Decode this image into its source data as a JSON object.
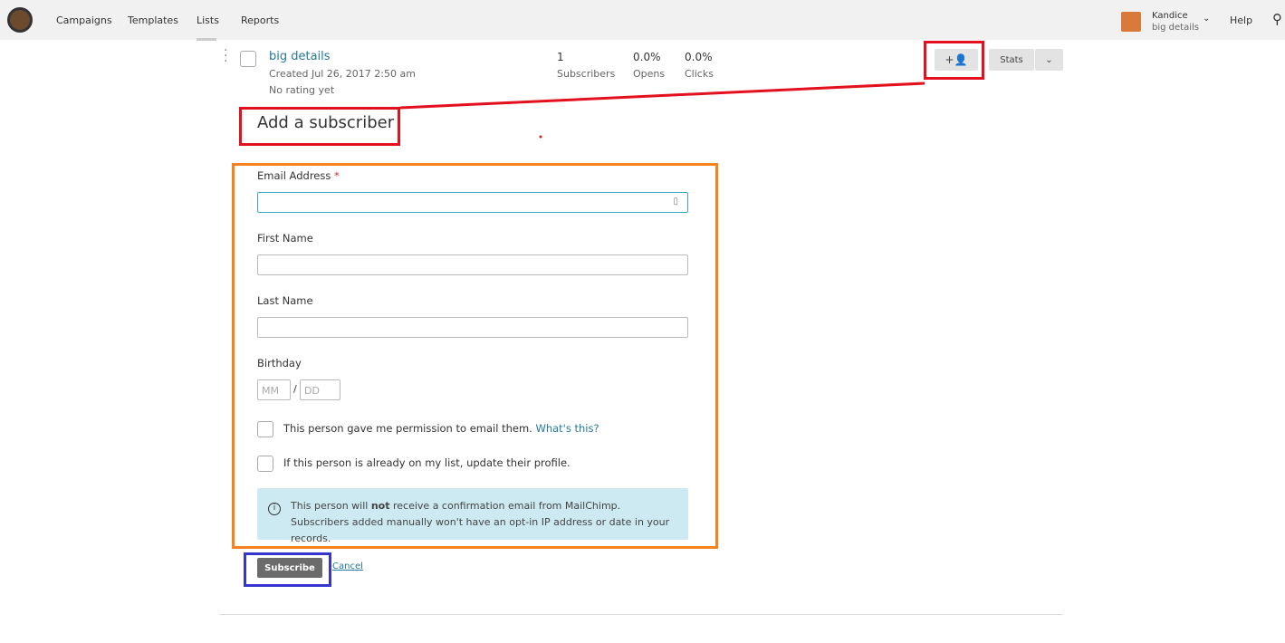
{
  "nav": {
    "items": [
      "Campaigns",
      "Templates",
      "Lists",
      "Reports"
    ],
    "active": "Lists",
    "user_name": "Kandice",
    "user_sub": "big details",
    "help": "Help"
  },
  "list": {
    "name": "big details",
    "created": "Created Jul 26, 2017 2:50 am",
    "rating": "No rating yet",
    "stats": [
      {
        "value": "1",
        "label": "Subscribers"
      },
      {
        "value": "0.0%",
        "label": "Opens"
      },
      {
        "value": "0.0%",
        "label": "Clicks"
      }
    ],
    "stats_button": "Stats"
  },
  "form": {
    "title": "Add a subscriber",
    "email_label": "Email Address",
    "required": "*",
    "first_name_label": "First Name",
    "last_name_label": "Last Name",
    "birthday_label": "Birthday",
    "mm_placeholder": "MM",
    "dd_placeholder": "DD",
    "slash": "/",
    "permission_text": "This person gave me permission to email them.",
    "whats_this": "What's this?",
    "update_text": "If this person is already on my list, update their profile.",
    "info_pre": "This person will ",
    "info_bold": "not",
    "info_post": " receive a confirmation email from MailChimp. Subscribers added manually won't have an opt-in IP address or date in your records.",
    "subscribe": "Subscribe",
    "cancel": "Cancel"
  },
  "colors": {
    "link": "#24799a",
    "annotation_red": "#e3101d",
    "annotation_orange": "#f7821f",
    "annotation_blue": "#3535cf",
    "info_bg": "#cdeaf2"
  }
}
